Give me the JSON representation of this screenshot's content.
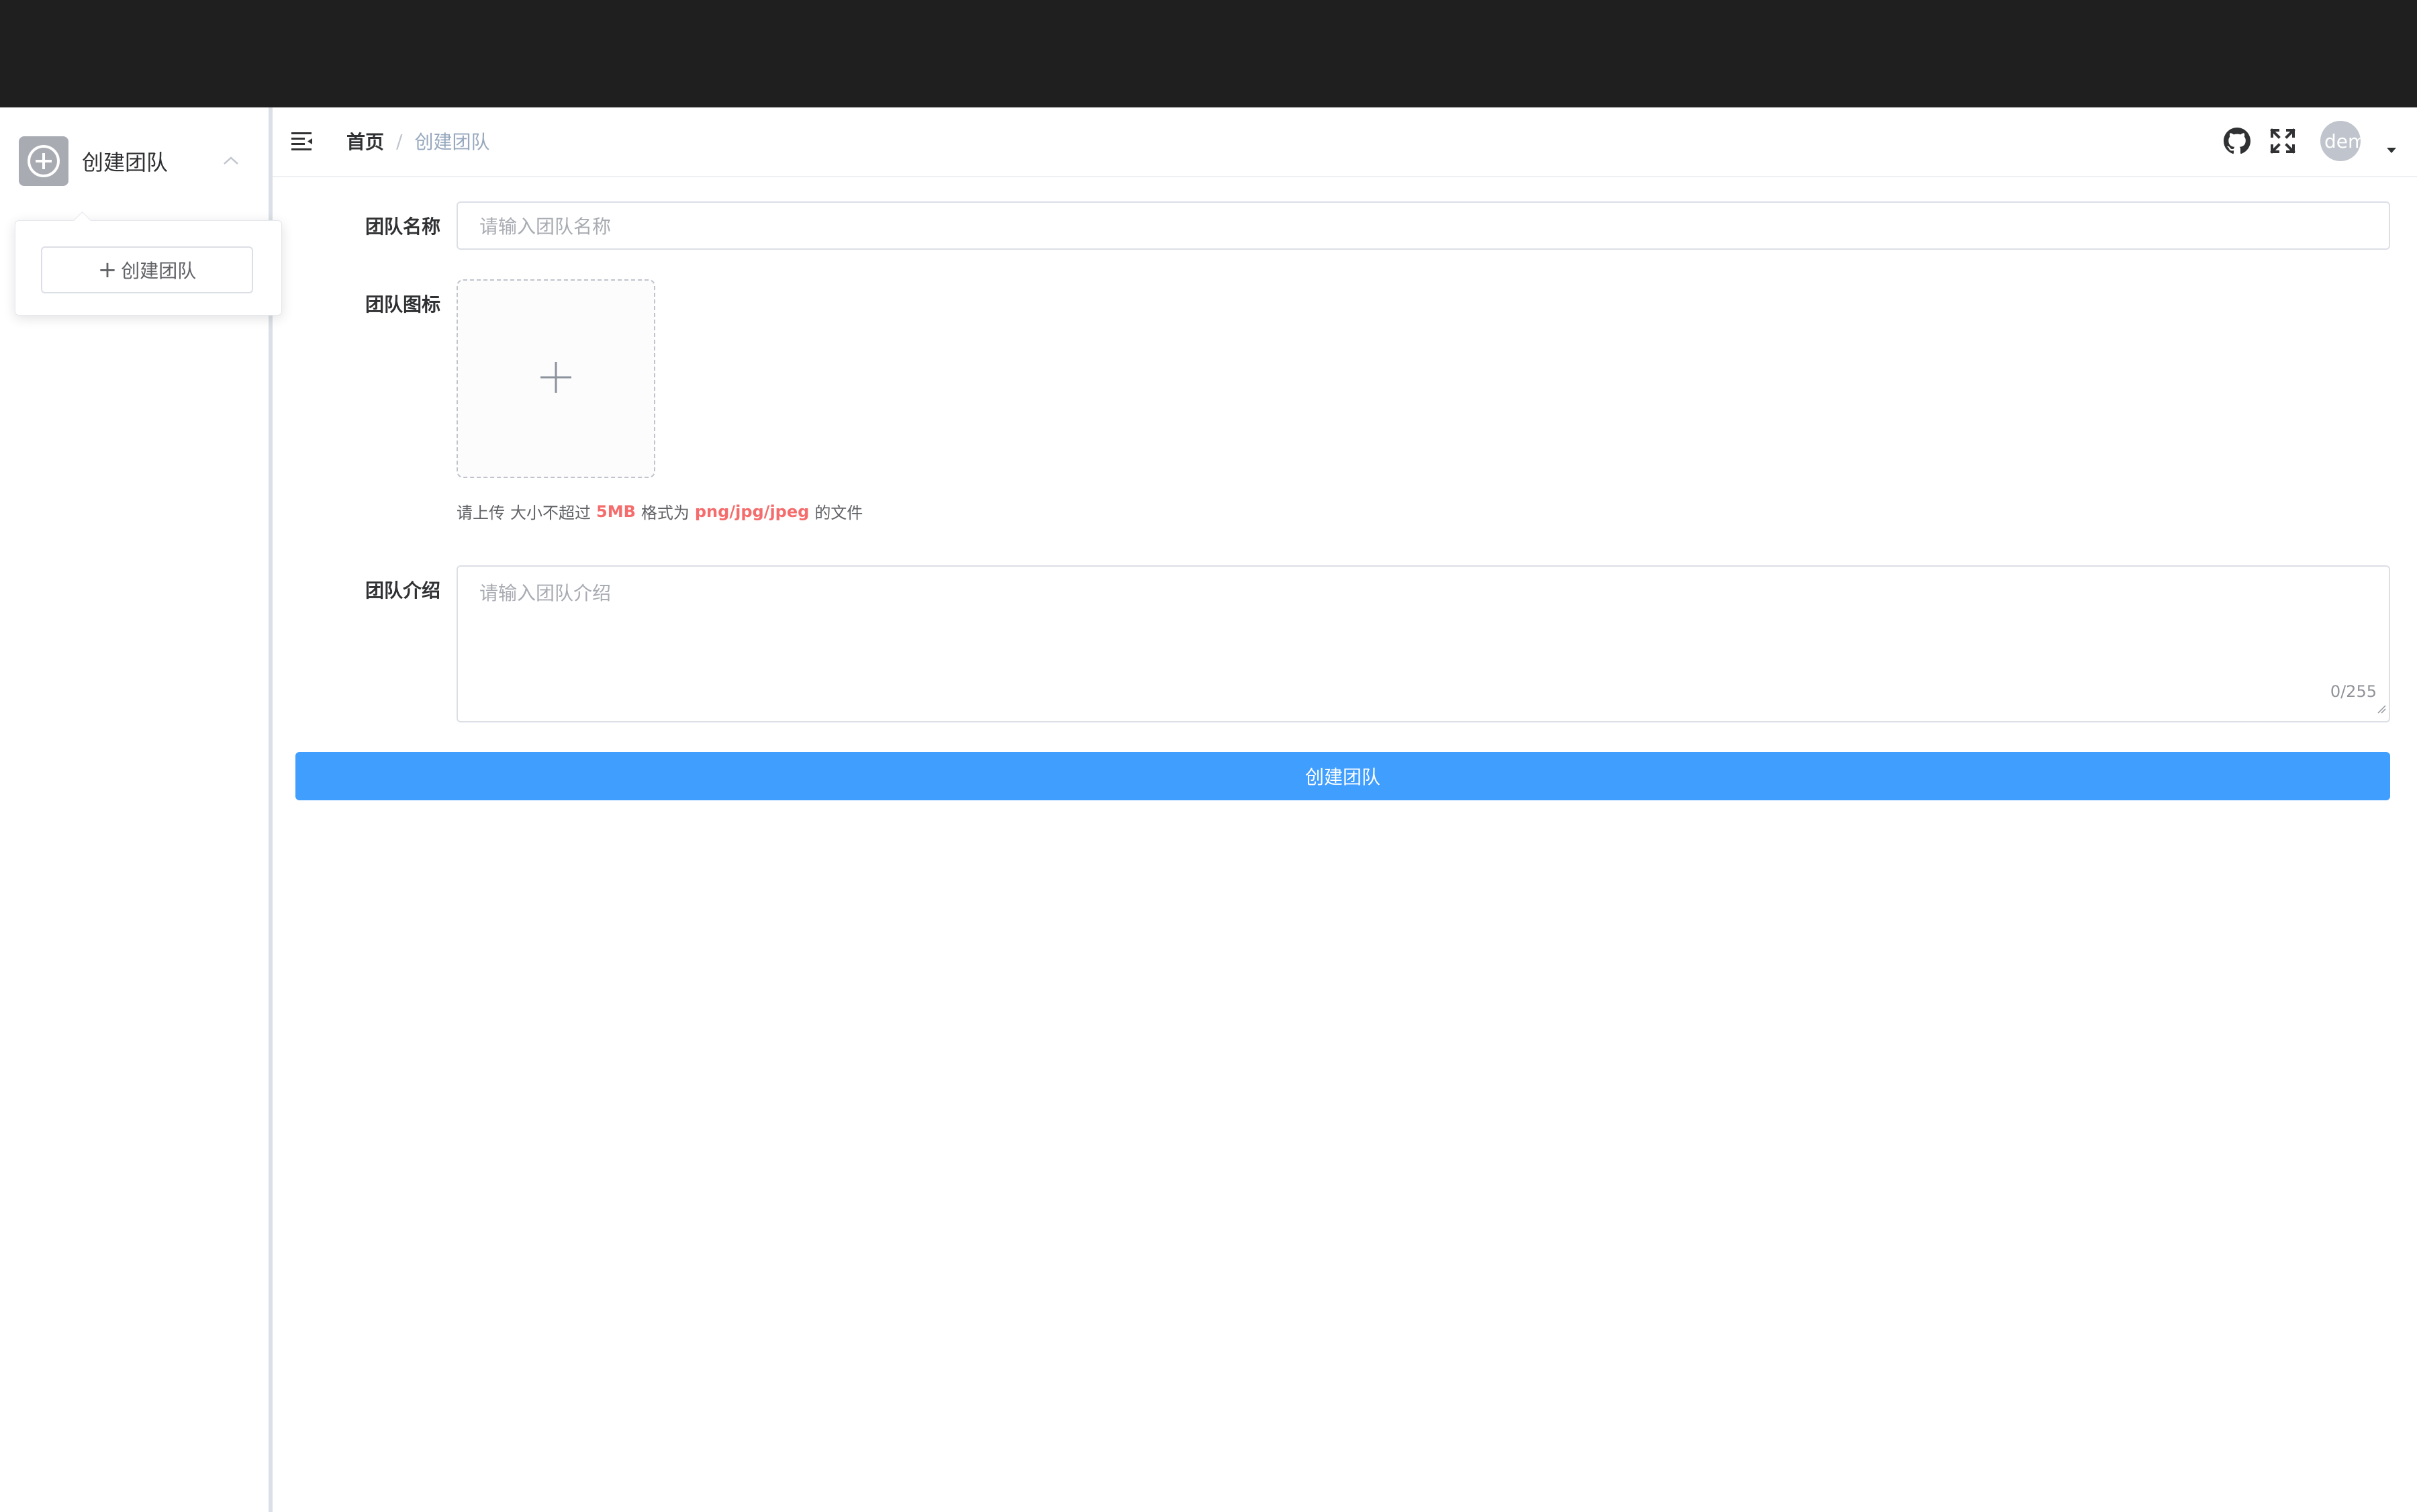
{
  "sidebar": {
    "team_name": "创建团队",
    "logo_icon": "plus-circle-icon",
    "dropdown": {
      "create_button_label": "创建团队",
      "icon": "plus-icon"
    }
  },
  "header": {
    "menu_icon": "fold-menu-icon",
    "breadcrumb": {
      "home": "首页",
      "separator": "/",
      "current": "创建团队"
    },
    "icons": [
      "github-icon",
      "fullscreen-icon"
    ],
    "avatar_text": "demo"
  },
  "form": {
    "name": {
      "label": "团队名称",
      "placeholder": "请输入团队名称"
    },
    "icon": {
      "label": "团队图标",
      "tip": {
        "prefix": "请上传",
        "size_text": "大小不超过",
        "size_value": "5MB",
        "format_text": "格式为",
        "format_value": "png/jpg/jpeg",
        "suffix": "的文件"
      }
    },
    "intro": {
      "label": "团队介绍",
      "placeholder": "请输入团队介绍",
      "counter": "0/255"
    },
    "submit_label": "创建团队"
  },
  "colors": {
    "topbar": "#1f1f1f",
    "primary": "#409eff",
    "highlight": "#f56c6c"
  }
}
